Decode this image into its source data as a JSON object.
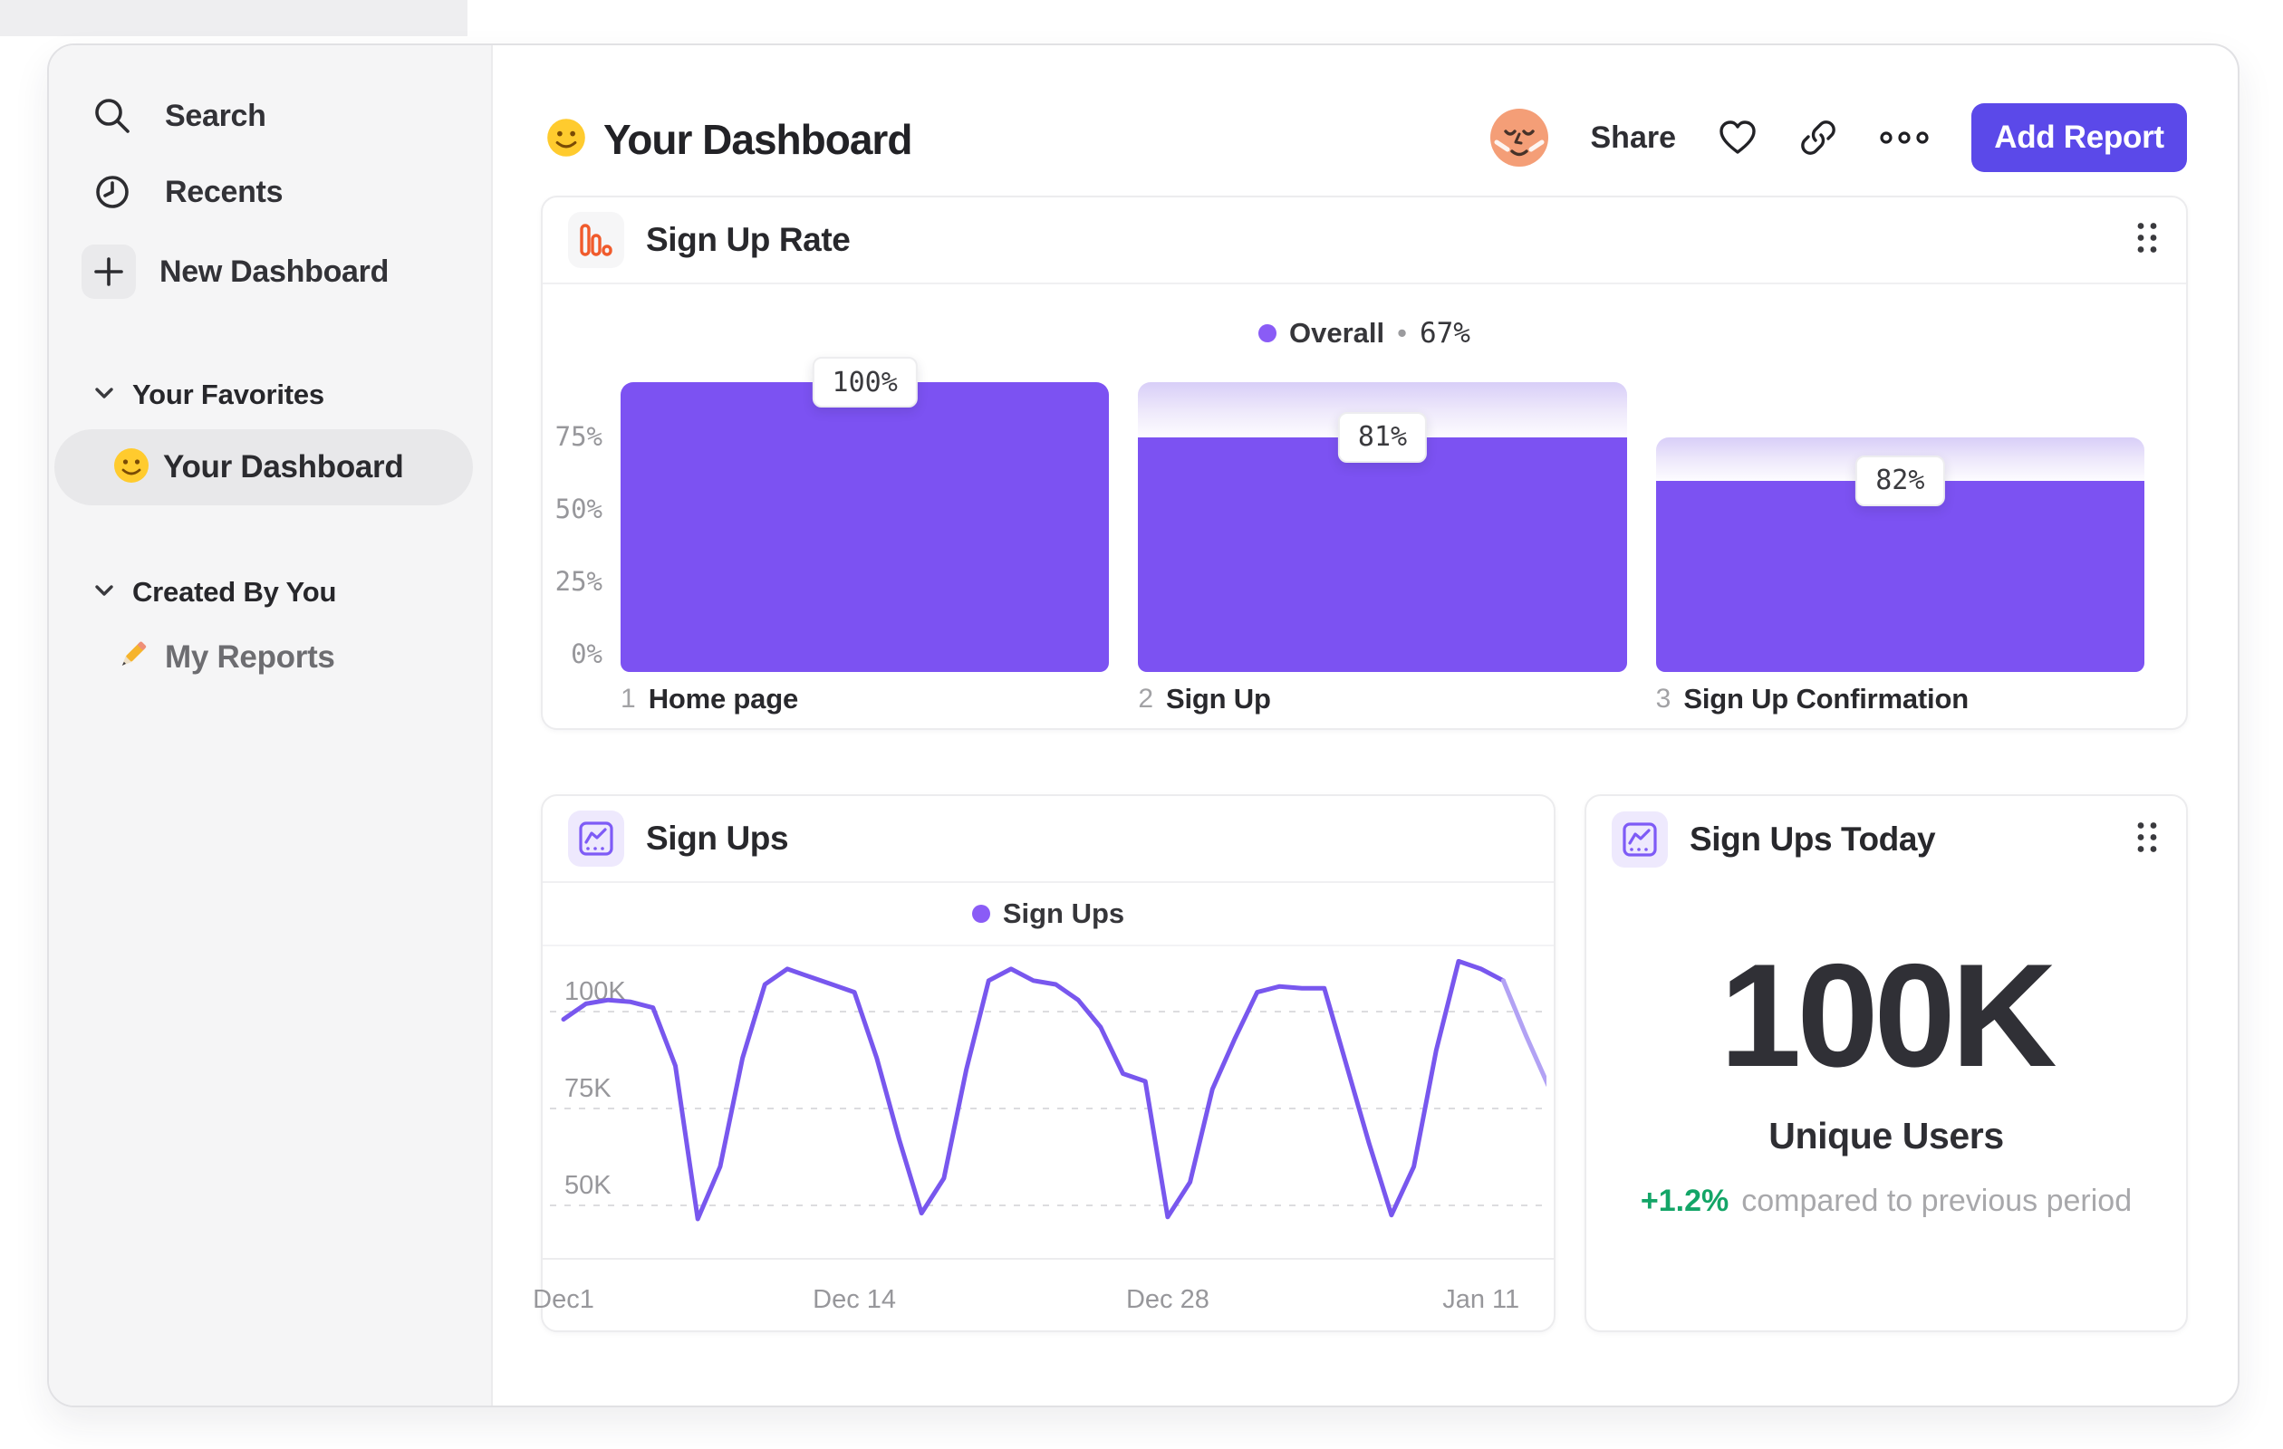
{
  "sidebar": {
    "items": [
      {
        "label": "Search",
        "icon": "search-icon"
      },
      {
        "label": "Recents",
        "icon": "clock-icon"
      },
      {
        "label": "New Dashboard",
        "icon": "plus-icon"
      }
    ],
    "sections": [
      {
        "label": "Your Favorites",
        "items": [
          {
            "label": "Your Dashboard",
            "icon": "smiley-emoji",
            "selected": true
          }
        ]
      },
      {
        "label": "Created By You",
        "items": [
          {
            "label": "My Reports",
            "icon": "pencil-emoji",
            "selected": false
          }
        ]
      }
    ]
  },
  "header": {
    "title": "Your Dashboard",
    "title_icon": "smiley-emoji",
    "share_label": "Share",
    "add_report_label": "Add Report"
  },
  "colors": {
    "accent_purple": "#7c52f2",
    "legend_dot": "#8a5cf6",
    "line_stroke": "#7857ee",
    "line_stroke_faded": "#b2a2f4",
    "button_purple": "#5b49e9",
    "funnel_icon_orange": "#f05b2c",
    "delta_green": "#13a567"
  },
  "chart_data": [
    {
      "type": "bar",
      "subtype": "funnel",
      "title": "Sign Up Rate",
      "legend": {
        "name": "Overall",
        "separator": "•",
        "value": "67%"
      },
      "categories": [
        "Home page",
        "Sign Up",
        "Sign Up Confirmation"
      ],
      "step_numbers": [
        "1",
        "2",
        "3"
      ],
      "conversion_labels": [
        "100%",
        "81%",
        "82%"
      ],
      "totals_pct": [
        100,
        100,
        81
      ],
      "fill_pct": [
        100,
        81,
        66
      ],
      "y_ticks": [
        {
          "label": "75%",
          "value": 75
        },
        {
          "label": "50%",
          "value": 50
        },
        {
          "label": "25%",
          "value": 25
        },
        {
          "label": "0%",
          "value": 0
        }
      ],
      "ylim": [
        0,
        100
      ],
      "grid": false,
      "legend_position": "top-center"
    },
    {
      "type": "line",
      "title": "Sign Ups",
      "legend": {
        "name": "Sign Ups"
      },
      "unit": "K",
      "ylim": [
        36,
        115
      ],
      "y_ticks": [
        {
          "label": "100K",
          "value": 100
        },
        {
          "label": "75K",
          "value": 75
        },
        {
          "label": "50K",
          "value": 50
        }
      ],
      "x_ticks": [
        {
          "label": "Dec1",
          "day": 0
        },
        {
          "label": "Dec 14",
          "day": 13
        },
        {
          "label": "Dec 28",
          "day": 27
        },
        {
          "label": "Jan 11",
          "day": 41
        }
      ],
      "series": [
        {
          "name": "Sign Ups",
          "values": [
            98,
            102,
            103,
            102.5,
            101,
            86,
            46.5,
            60,
            88,
            107,
            111,
            109,
            107,
            105,
            88,
            67,
            48,
            57,
            85,
            108,
            111,
            108,
            107,
            103,
            96,
            84,
            82,
            47,
            56,
            80,
            93,
            105,
            106.5,
            106,
            106,
            86,
            66,
            47.5,
            60,
            90,
            113,
            111,
            108,
            94,
            81
          ]
        }
      ],
      "fade_from_index": 42,
      "grid": "dotted-horizontal",
      "legend_position": "top-center"
    },
    {
      "type": "kpi",
      "title": "Sign Ups Today",
      "value": "100K",
      "label": "Unique Users",
      "delta": "+1.2%",
      "delta_note": "compared to previous period"
    }
  ]
}
